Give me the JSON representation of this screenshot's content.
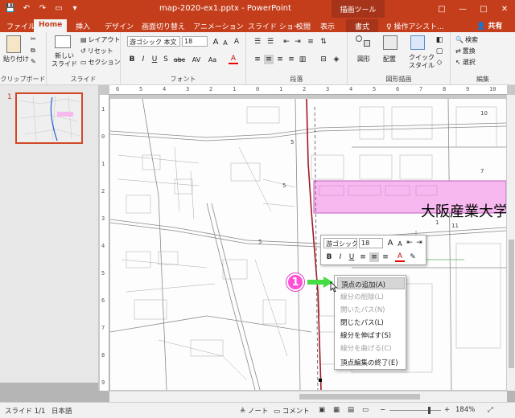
{
  "titlebar": {
    "doc_title": "map-2020-ex1.pptx - PowerPoint",
    "context_group": "描画ツール",
    "qat_save": "💾",
    "qat_undo": "↶",
    "qat_redo": "↷",
    "qat_present": "▭",
    "qat_more": "▾",
    "ctl_help": "□",
    "ctl_min": "—",
    "ctl_max": "□",
    "ctl_close": "✕"
  },
  "tabs": [
    {
      "label": "ファイル"
    },
    {
      "label": "Home"
    },
    {
      "label": "挿入"
    },
    {
      "label": "デザイン"
    },
    {
      "label": "画面切り替え"
    },
    {
      "label": "アニメーション"
    },
    {
      "label": "スライド ショー"
    },
    {
      "label": "校閲"
    },
    {
      "label": "表示"
    },
    {
      "label": "書式"
    }
  ],
  "tell_me": "♀ 操作アシスト...",
  "share": "👤 共有",
  "ribbon": {
    "clipboard": {
      "paste": "貼り付け",
      "label": "クリップボード"
    },
    "slides": {
      "new_slide_1": "新しい",
      "new_slide_2": "スライド",
      "layout": "レイアウト",
      "reset": "リセット",
      "section": "セクション",
      "label": "スライド"
    },
    "font": {
      "font_name": "游ゴシック 本文",
      "font_size": "18",
      "bold": "B",
      "italic": "I",
      "underline": "U",
      "shadow": "S",
      "strike": "abc",
      "spacing": "AV",
      "case": "Aa",
      "grow": "A",
      "shrink": "A",
      "clear": "A",
      "color": "A",
      "label": "フォント"
    },
    "paragraph": {
      "label": "段落"
    },
    "drawing": {
      "shapes": "図形",
      "arrange": "配置",
      "quick_style_1": "クイック",
      "quick_style_2": "スタイル",
      "label": "図形描画"
    },
    "editing": {
      "find": "検索",
      "replace": "置換",
      "select": "選択",
      "label": "編集"
    }
  },
  "slide_panel": {
    "slide_number": "1"
  },
  "map": {
    "label_text": "大阪産業大学",
    "num_5a": "5",
    "num_5b": "5",
    "num_5c": "5",
    "num_1": "1",
    "num_7": "7",
    "num_10": "10",
    "num_11": "11"
  },
  "ruler": {
    "h": [
      "6",
      "5",
      "4",
      "3",
      "2",
      "1",
      "0",
      "1",
      "2",
      "3",
      "4",
      "5",
      "6",
      "7",
      "8",
      "9",
      "10"
    ],
    "v": [
      "1",
      "0",
      "1",
      "2",
      "3",
      "4",
      "5",
      "6",
      "7",
      "8",
      "9"
    ]
  },
  "mini_toolbar": {
    "font_name": "游ゴシック",
    "font_size": "18",
    "grow": "A",
    "shrink": "A",
    "bold": "B",
    "italic": "I",
    "underline": "U",
    "color": "A"
  },
  "callout": {
    "number": "1"
  },
  "context_menu": {
    "items": [
      {
        "label": "頂点の追加(A)",
        "state": "highlighted"
      },
      {
        "label": "線分の削除(L)",
        "state": "disabled"
      },
      {
        "label": "開いたパス(N)",
        "state": "disabled"
      },
      {
        "label": "閉じたパス(L)",
        "state": "normal"
      },
      {
        "label": "線分を伸ばす(S)",
        "state": "normal"
      },
      {
        "label": "線分を曲げる(C)",
        "state": "disabled"
      },
      {
        "label": "頂点編集の終了(E)",
        "state": "normal"
      }
    ]
  },
  "statusbar": {
    "slide": "スライド 1/1",
    "lang": "日本語",
    "notes": "≜ ノート",
    "comments": "▭ コメント",
    "zoom_minus": "−",
    "zoom_plus": "+",
    "zoom": "184%"
  },
  "colors": {
    "brand": "#c43e1c",
    "highlight": "#f7b8f0",
    "route": "#a01820",
    "callout": "#ff4fd8",
    "arrow": "#44dd44"
  }
}
